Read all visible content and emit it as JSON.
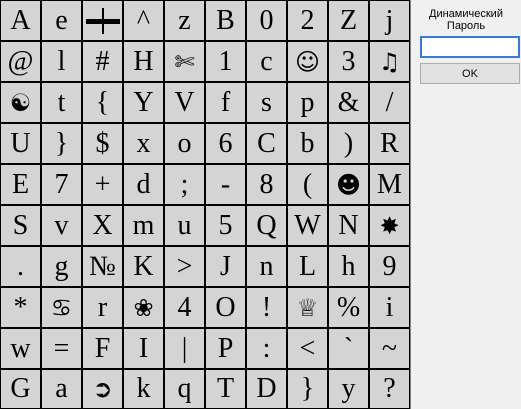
{
  "grid": {
    "rows": [
      [
        {
          "t": "A"
        },
        {
          "t": "e"
        },
        {
          "t": "",
          "icon": "crossbar-icon"
        },
        {
          "t": "^"
        },
        {
          "t": "z"
        },
        {
          "t": "B"
        },
        {
          "t": "0"
        },
        {
          "t": "2"
        },
        {
          "t": "Z"
        },
        {
          "t": "j"
        }
      ],
      [
        {
          "t": "@"
        },
        {
          "t": "l"
        },
        {
          "t": "#"
        },
        {
          "t": "H"
        },
        {
          "t": "✄",
          "icon": "scissors-icon"
        },
        {
          "t": "1"
        },
        {
          "t": "c"
        },
        {
          "t": "☺",
          "icon": "smiley-outline-icon"
        },
        {
          "t": "3"
        },
        {
          "t": "♫",
          "icon": "music-notes-icon"
        }
      ],
      [
        {
          "t": "☯",
          "icon": "yin-yang-icon"
        },
        {
          "t": "t"
        },
        {
          "t": "{"
        },
        {
          "t": "Y"
        },
        {
          "t": "V"
        },
        {
          "t": "f"
        },
        {
          "t": "s"
        },
        {
          "t": "p"
        },
        {
          "t": "&"
        },
        {
          "t": "/"
        }
      ],
      [
        {
          "t": "U"
        },
        {
          "t": "}"
        },
        {
          "t": "$"
        },
        {
          "t": "x"
        },
        {
          "t": "o"
        },
        {
          "t": "6"
        },
        {
          "t": "C"
        },
        {
          "t": "b"
        },
        {
          "t": ")"
        },
        {
          "t": "R"
        }
      ],
      [
        {
          "t": "E"
        },
        {
          "t": "7"
        },
        {
          "t": "+"
        },
        {
          "t": "d"
        },
        {
          "t": ";"
        },
        {
          "t": "-"
        },
        {
          "t": "8"
        },
        {
          "t": "("
        },
        {
          "t": "☻",
          "icon": "smiley-filled-icon"
        },
        {
          "t": "M"
        }
      ],
      [
        {
          "t": "S"
        },
        {
          "t": "v"
        },
        {
          "t": "X"
        },
        {
          "t": "m"
        },
        {
          "t": "u"
        },
        {
          "t": "5"
        },
        {
          "t": "Q"
        },
        {
          "t": "W"
        },
        {
          "t": "N"
        },
        {
          "t": "✸",
          "icon": "star-burst-icon"
        }
      ],
      [
        {
          "t": "."
        },
        {
          "t": "g"
        },
        {
          "t": "№"
        },
        {
          "t": "K"
        },
        {
          "t": ">"
        },
        {
          "t": "J"
        },
        {
          "t": "n"
        },
        {
          "t": "L"
        },
        {
          "t": "h"
        },
        {
          "t": "9"
        }
      ],
      [
        {
          "t": "*"
        },
        {
          "t": "♋",
          "icon": "cancer-sign-icon"
        },
        {
          "t": "r"
        },
        {
          "t": "❀",
          "icon": "flower-icon"
        },
        {
          "t": "4"
        },
        {
          "t": "O"
        },
        {
          "t": "!"
        },
        {
          "t": "♕",
          "icon": "crown-icon"
        },
        {
          "t": "%"
        },
        {
          "t": "i"
        }
      ],
      [
        {
          "t": "w"
        },
        {
          "t": "="
        },
        {
          "t": "F"
        },
        {
          "t": "I"
        },
        {
          "t": "|"
        },
        {
          "t": "P"
        },
        {
          "t": ":"
        },
        {
          "t": "<"
        },
        {
          "t": "`"
        },
        {
          "t": "~"
        }
      ],
      [
        {
          "t": "G"
        },
        {
          "t": "a"
        },
        {
          "t": "➲",
          "icon": "arrow-circle-icon"
        },
        {
          "t": "k"
        },
        {
          "t": "q"
        },
        {
          "t": "T"
        },
        {
          "t": "D"
        },
        {
          "t": "}"
        },
        {
          "t": "y"
        },
        {
          "t": "?"
        }
      ]
    ]
  },
  "panel": {
    "title_line1": "Динамический",
    "title_line2": "Пароль",
    "password_value": "",
    "ok_label": "OK"
  }
}
